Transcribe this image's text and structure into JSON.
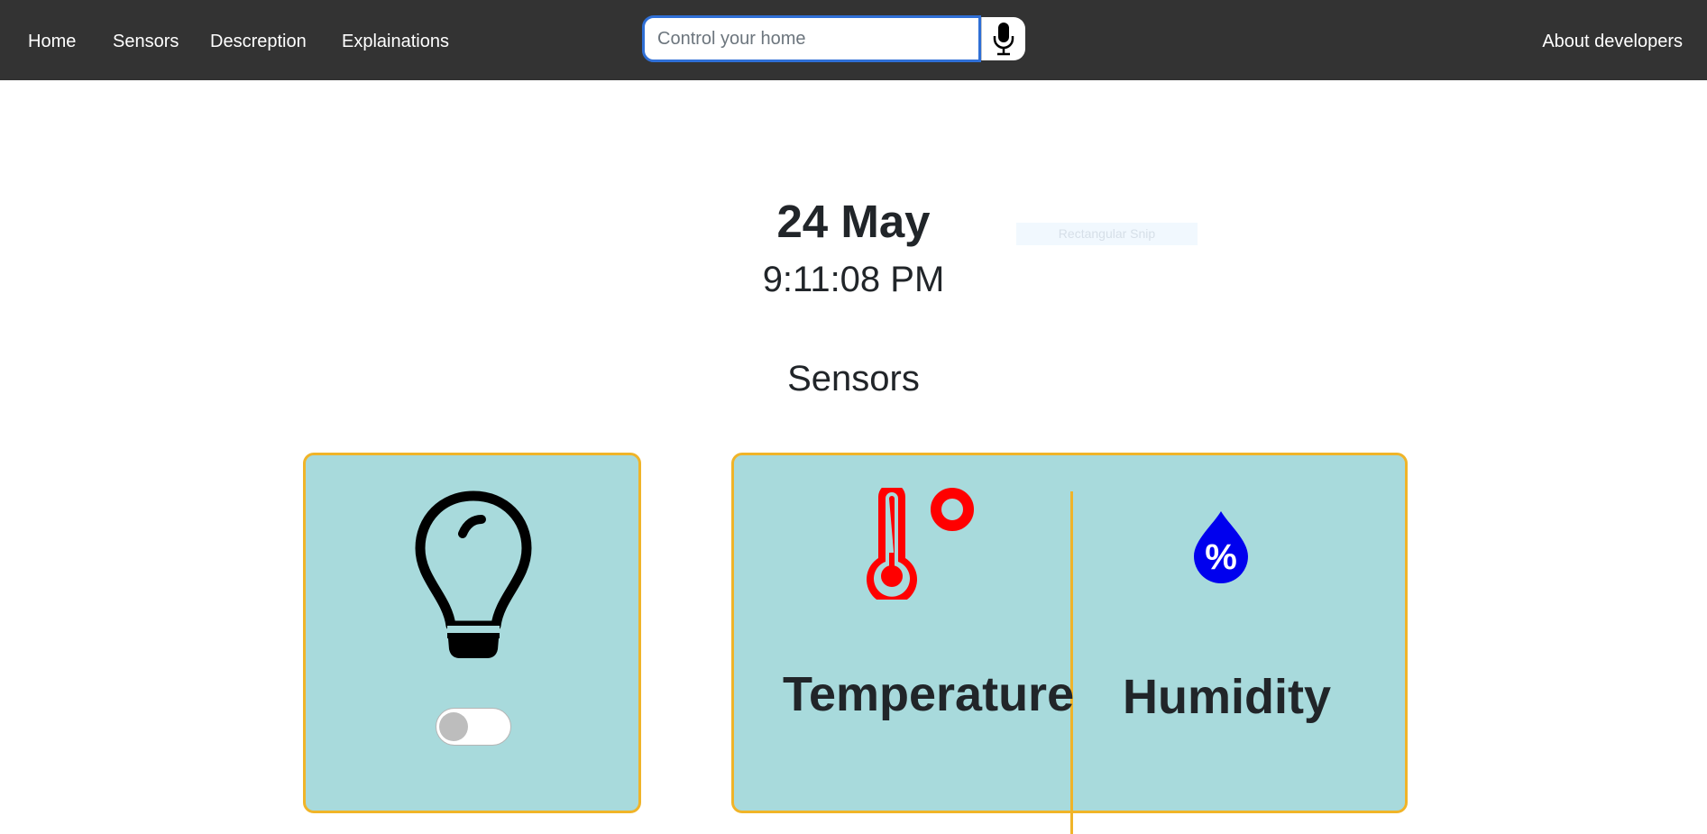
{
  "nav": {
    "home": "Home",
    "sensors": "Sensors",
    "description": "Descreption",
    "explanations": "Explainations",
    "about": "About developers"
  },
  "search": {
    "placeholder": "Control your home",
    "value": ""
  },
  "clock": {
    "date": "24 May",
    "time": "9:11:08 PM"
  },
  "overlay": {
    "snip_label": "Rectangular Snip"
  },
  "section": {
    "title": "Sensors"
  },
  "cards": {
    "light": {
      "icon": "lightbulb-icon",
      "toggle_on": false
    },
    "temperature": {
      "icon": "thermometer-icon",
      "label": "Temperature",
      "icon_color": "#ff0000"
    },
    "humidity": {
      "icon": "humidity-drop-icon",
      "label": "Humidity",
      "icon_color": "#0000ee"
    }
  },
  "colors": {
    "navbar": "#333333",
    "card_bg": "#a8dadc",
    "card_border": "#f0b429",
    "search_focus": "#2f6fd6"
  }
}
